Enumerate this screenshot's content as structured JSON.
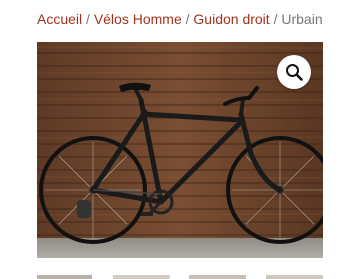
{
  "breadcrumb": {
    "items": [
      {
        "label": "Accueil"
      },
      {
        "label": "Vélos Homme"
      },
      {
        "label": "Guidon droit"
      }
    ],
    "separator": "/",
    "current": "Urbain"
  },
  "gallery": {
    "main_image": {
      "subject": "black-road-bicycle",
      "background": "wooden-plank-wall"
    },
    "zoom_icon": "magnifier-icon",
    "thumbnail_count_visible": 4
  },
  "colors": {
    "link": "#a0331a",
    "current": "#777777"
  }
}
